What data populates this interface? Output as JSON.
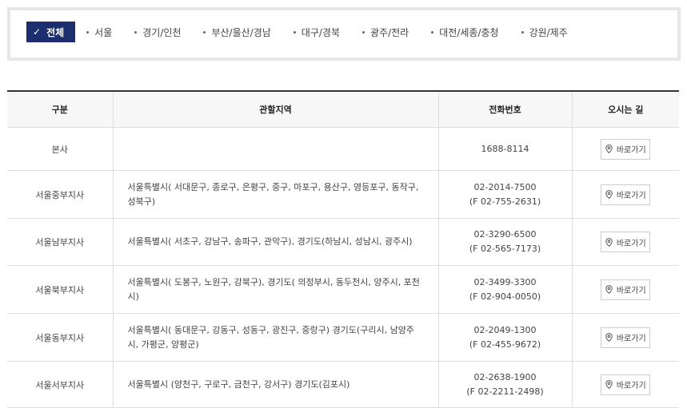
{
  "tabs": [
    {
      "label": "전체",
      "active": true
    },
    {
      "label": "서울"
    },
    {
      "label": "경기/인천"
    },
    {
      "label": "부산/울산/경남"
    },
    {
      "label": "대구/경북"
    },
    {
      "label": "광주/전라"
    },
    {
      "label": "대전/세종/충청"
    },
    {
      "label": "강원/제주"
    }
  ],
  "table": {
    "headers": [
      "구분",
      "관할지역",
      "전화번호",
      "오시는 길"
    ],
    "button_label": "바로가기",
    "rows": [
      {
        "name": "본사",
        "region": "",
        "phone": "1688-8114",
        "fax": ""
      },
      {
        "name": "서울중부지사",
        "region": "서울특별시( 서대문구, 종로구, 은평구, 중구, 마포구, 용산구, 영등포구, 동작구, 성북구)",
        "phone": "02-2014-7500",
        "fax": "(F 02-755-2631)"
      },
      {
        "name": "서울남부지사",
        "region": "서울특별시( 서초구, 강남구, 송파구, 관악구), 경기도(하남시, 성남시, 광주시)",
        "phone": "02-3290-6500",
        "fax": "(F 02-565-7173)"
      },
      {
        "name": "서울북부지사",
        "region": "서울특별시( 도봉구, 노원구, 강북구), 경기도( 의정부시, 동두천시, 양주시, 포천시)",
        "phone": "02-3499-3300",
        "fax": "(F 02-904-0050)"
      },
      {
        "name": "서울동부지사",
        "region": "서울특별시( 동대문구, 강동구, 성동구, 광진구, 중랑구) 경기도(구리시, 남양주시, 가평군, 양평군)",
        "phone": "02-2049-1300",
        "fax": "(F 02-455-9672)"
      },
      {
        "name": "서울서부지사",
        "region": "서울특별시 (양천구, 구로구, 금천구, 강서구) 경기도(김포시)",
        "phone": "02-2638-1900",
        "fax": "(F 02-2211-2498)"
      }
    ]
  },
  "colors": {
    "accent": "#1c2e6e",
    "header_bg": "#f7f7f7",
    "border": "#dddddd"
  },
  "icons": {
    "check": "check-icon",
    "pin": "map-pin-icon"
  }
}
